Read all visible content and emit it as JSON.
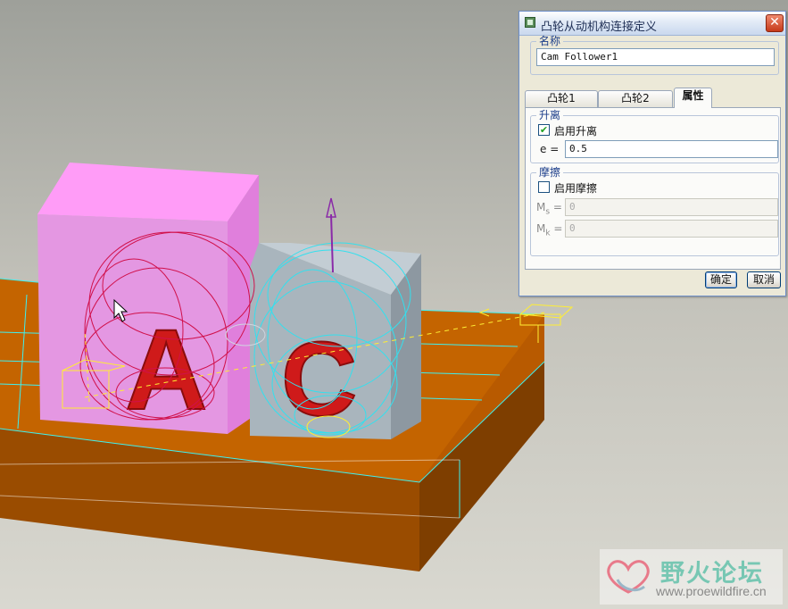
{
  "viewport": {
    "label_a": "A",
    "label_c": "C"
  },
  "dialog": {
    "title": "凸轮从动机构连接定义",
    "name_group": "名称",
    "name_value": "Cam Follower1",
    "tabs": [
      {
        "label": "凸轮1",
        "active": false
      },
      {
        "label": "凸轮2",
        "active": false
      },
      {
        "label": "属性",
        "active": true
      }
    ],
    "liftoff": {
      "group": "升离",
      "checkbox_label": "启用升离",
      "checked": true,
      "e_label": "e =",
      "e_value": "0.5"
    },
    "friction": {
      "group": "摩擦",
      "checkbox_label": "启用摩擦",
      "checked": false,
      "mus_label": "M",
      "mus_sub": "s",
      "muk_label": "M",
      "muk_sub": "k",
      "eq": "=",
      "mus_value": "0",
      "muk_value": "0"
    },
    "ok": "确定",
    "cancel": "取消"
  },
  "watermark": {
    "cn": "野火论坛",
    "url": "www.proewildfire.cn"
  },
  "colors": {
    "background": "#d6d5cd",
    "platform": "#c06000",
    "block_a": "#e090e0",
    "block_c": "#a8b4bc",
    "letter": "#d01818",
    "cam_a_wire": "#d0104a",
    "cam_c_wire": "#33e0ee",
    "edges": "#3ef0f0",
    "markers": "#ffee33"
  }
}
